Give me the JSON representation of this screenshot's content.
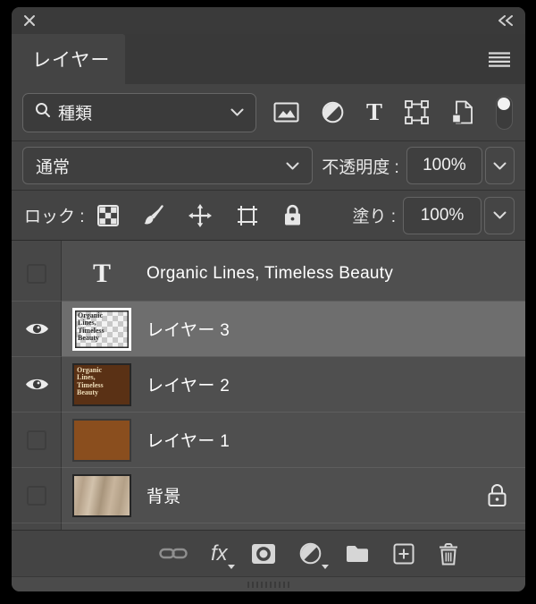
{
  "tabs": {
    "layers_label": "レイヤー"
  },
  "filter_row": {
    "search_value": "種類",
    "type_glyph": "T"
  },
  "blend_row": {
    "blend_mode": "通常",
    "opacity_label": "不透明度 :",
    "opacity_value": "100%"
  },
  "lock_row": {
    "label": "ロック :",
    "fill_label": "塗り :",
    "fill_value": "100%"
  },
  "layers": [
    {
      "name": "Organic Lines, Timeless Beauty",
      "kind": "text",
      "visible": false,
      "selected": false,
      "thumb_glyph": "T"
    },
    {
      "name": "レイヤー 3",
      "kind": "pixel",
      "visible": true,
      "selected": true,
      "thumb_text": "Organic\nLines,\nTimeless\nBeauty"
    },
    {
      "name": "レイヤー 2",
      "kind": "pixel",
      "visible": true,
      "selected": false,
      "thumb_text": "Organic\nLines,\nTimeless\nBeauty"
    },
    {
      "name": "レイヤー 1",
      "kind": "pixel",
      "visible": false,
      "selected": false
    },
    {
      "name": "背景",
      "kind": "background",
      "visible": false,
      "selected": false,
      "locked": true
    }
  ],
  "bottom_bar": {
    "fx_label": "fx"
  },
  "colors": {
    "panel_bg": "#444444",
    "selected_row": "#6e6e6e",
    "layer1_brown": "#8a4e1e",
    "layer2_brown": "#5a3115"
  }
}
